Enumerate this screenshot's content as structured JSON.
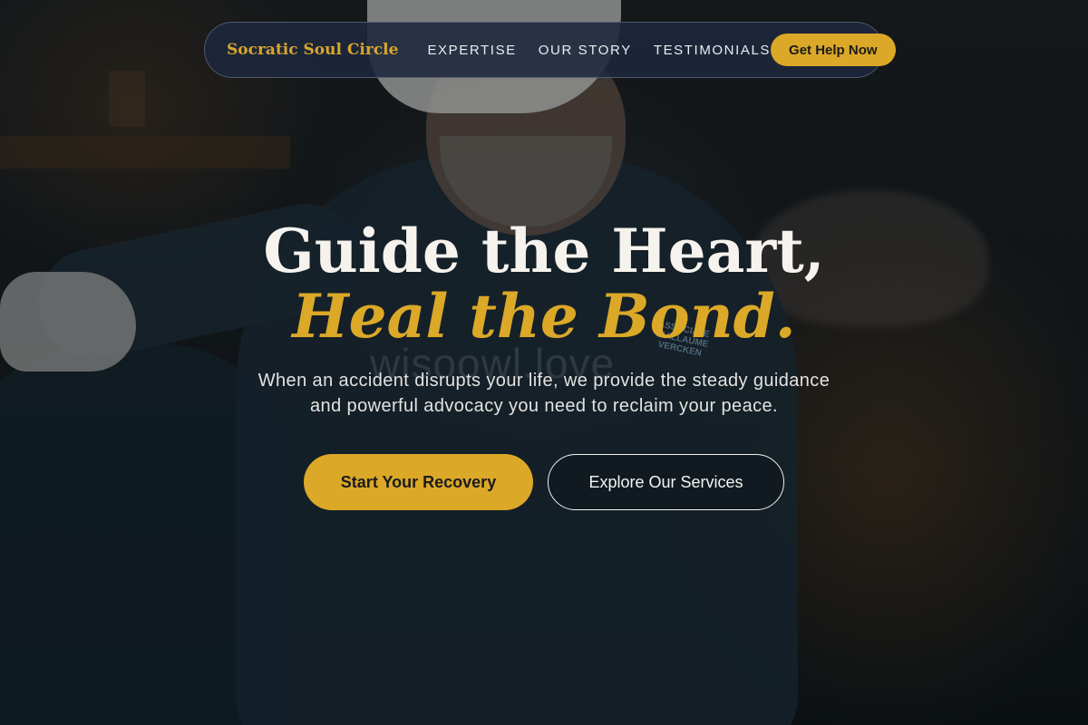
{
  "nav": {
    "brand": "Socratic Soul Circle",
    "links": [
      "EXPERTISE",
      "OUR STORY",
      "TESTIMONIALS"
    ],
    "cta": "Get Help Now"
  },
  "hero": {
    "headline_line1": "Guide the Heart,",
    "headline_line2": "Heal the Bond.",
    "subtext_line1": "When an accident disrupts your life, we provide the steady guidance",
    "subtext_line2": "and powerful advocacy you need to reclaim your peace.",
    "primary_cta": "Start Your Recovery",
    "secondary_cta": "Explore Our Services",
    "watermark": "wisoowl.love",
    "watermark_badge": "ASSOCIATE GUILLAUME VERCKEN"
  },
  "colors": {
    "accent": "#dba828",
    "nav_bg": "#1e283c",
    "text_light": "#f6f3ee"
  }
}
